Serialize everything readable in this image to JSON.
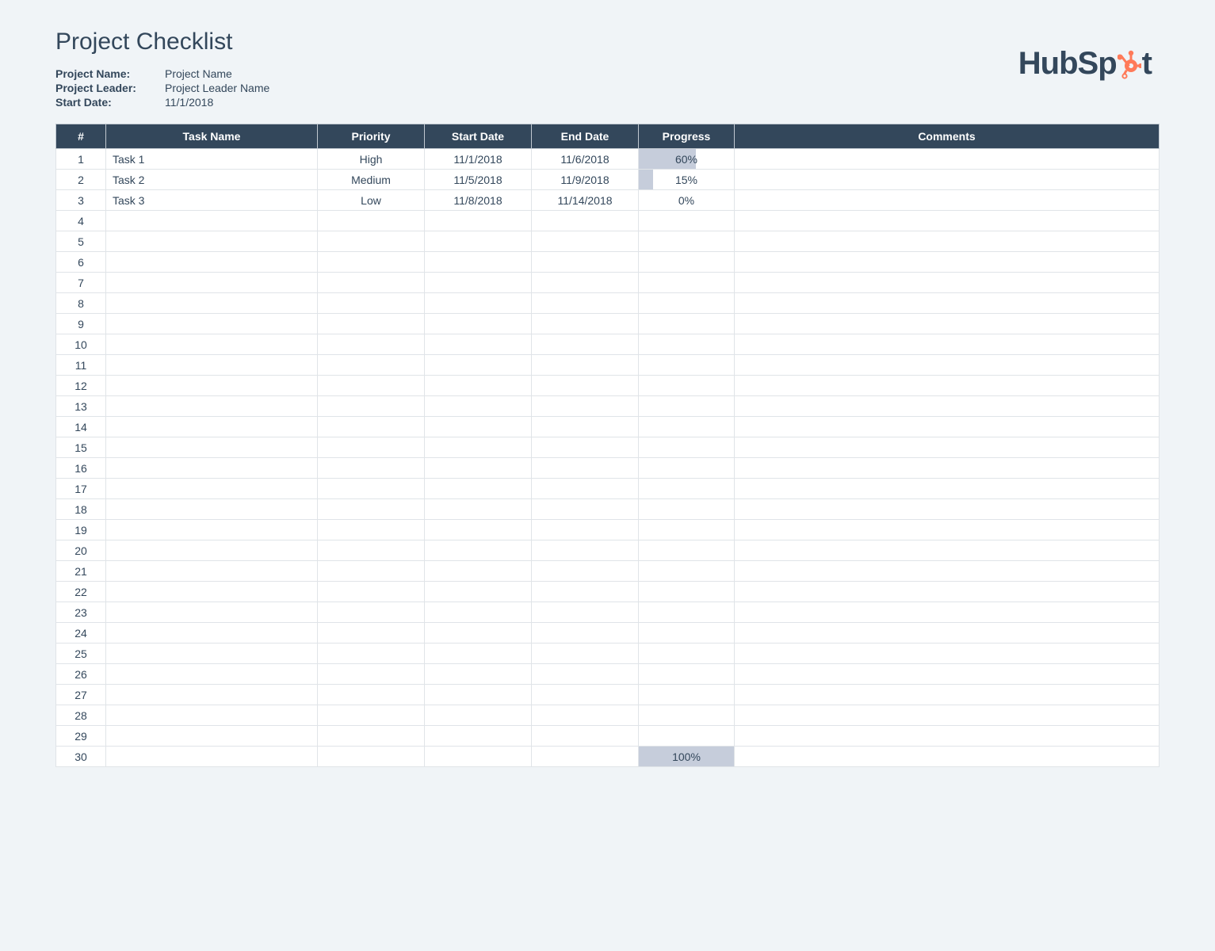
{
  "title": "Project Checklist",
  "meta": {
    "project_name_label": "Project Name:",
    "project_name_value": "Project Name",
    "project_leader_label": "Project Leader:",
    "project_leader_value": "Project Leader Name",
    "start_date_label": "Start Date:",
    "start_date_value": "11/1/2018"
  },
  "logo_text_before": "HubSp",
  "logo_text_after": "t",
  "headers": {
    "num": "#",
    "task": "Task Name",
    "priority": "Priority",
    "start": "Start Date",
    "end": "End Date",
    "progress": "Progress",
    "comments": "Comments"
  },
  "total_rows": 30,
  "rows": [
    {
      "num": "1",
      "task": "Task 1",
      "priority": "High",
      "priority_class": "pri-high",
      "start": "11/1/2018",
      "end": "11/6/2018",
      "progress_pct": 60,
      "progress_label": "60%",
      "comments": ""
    },
    {
      "num": "2",
      "task": "Task 2",
      "priority": "Medium",
      "priority_class": "pri-medium",
      "start": "11/5/2018",
      "end": "11/9/2018",
      "progress_pct": 15,
      "progress_label": "15%",
      "comments": ""
    },
    {
      "num": "3",
      "task": "Task 3",
      "priority": "Low",
      "priority_class": "pri-low",
      "start": "11/8/2018",
      "end": "11/14/2018",
      "progress_pct": 0,
      "progress_label": "0%",
      "comments": ""
    }
  ],
  "footer_row": {
    "num": "30",
    "progress_pct": 100,
    "progress_label": "100%"
  }
}
